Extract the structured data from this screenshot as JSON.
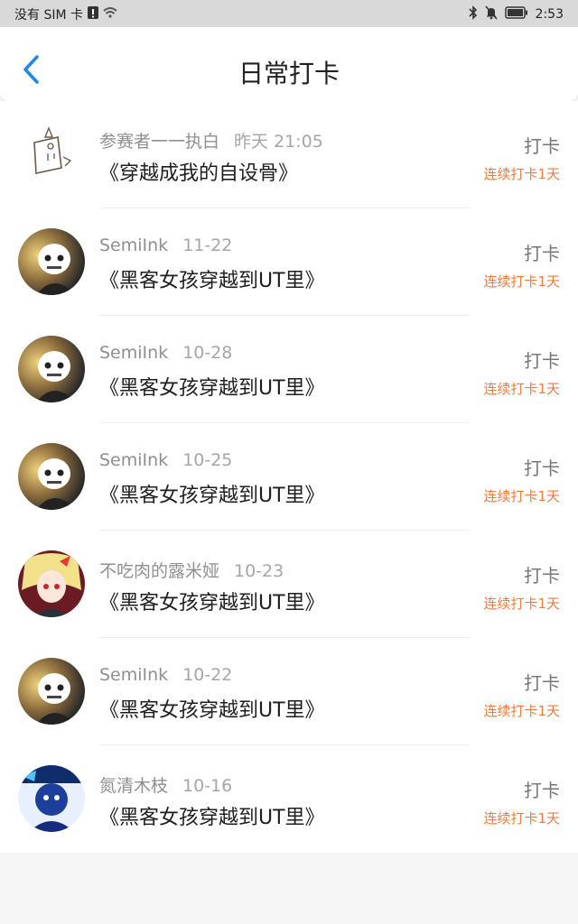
{
  "status_bar": {
    "carrier": "没有 SIM 卡",
    "time": "2:53"
  },
  "header": {
    "title": "日常打卡"
  },
  "list": [
    {
      "name": "参赛者一一执白",
      "date": "昨天 21:05",
      "book": "《穿越成我的自设骨》",
      "action": "打卡",
      "streak": "连续打卡1天",
      "avatar": "sketch"
    },
    {
      "name": "SemiInk",
      "date": "11-22",
      "book": "《黑客女孩穿越到UT里》",
      "action": "打卡",
      "streak": "连续打卡1天",
      "avatar": "skeleton"
    },
    {
      "name": "SemiInk",
      "date": "10-28",
      "book": "《黑客女孩穿越到UT里》",
      "action": "打卡",
      "streak": "连续打卡1天",
      "avatar": "skeleton"
    },
    {
      "name": "SemiInk",
      "date": "10-25",
      "book": "《黑客女孩穿越到UT里》",
      "action": "打卡",
      "streak": "连续打卡1天",
      "avatar": "skeleton"
    },
    {
      "name": "不吃肉的露米娅",
      "date": "10-23",
      "book": "《黑客女孩穿越到UT里》",
      "action": "打卡",
      "streak": "连续打卡1天",
      "avatar": "anime-girl"
    },
    {
      "name": "SemiInk",
      "date": "10-22",
      "book": "《黑客女孩穿越到UT里》",
      "action": "打卡",
      "streak": "连续打卡1天",
      "avatar": "skeleton"
    },
    {
      "name": "氮清木枝",
      "date": "10-16",
      "book": "《黑客女孩穿越到UT里》",
      "action": "打卡",
      "streak": "连续打卡1天",
      "avatar": "blue-character"
    }
  ],
  "colors": {
    "accent": "#1e88e5",
    "streak": "#ee7c3f"
  }
}
